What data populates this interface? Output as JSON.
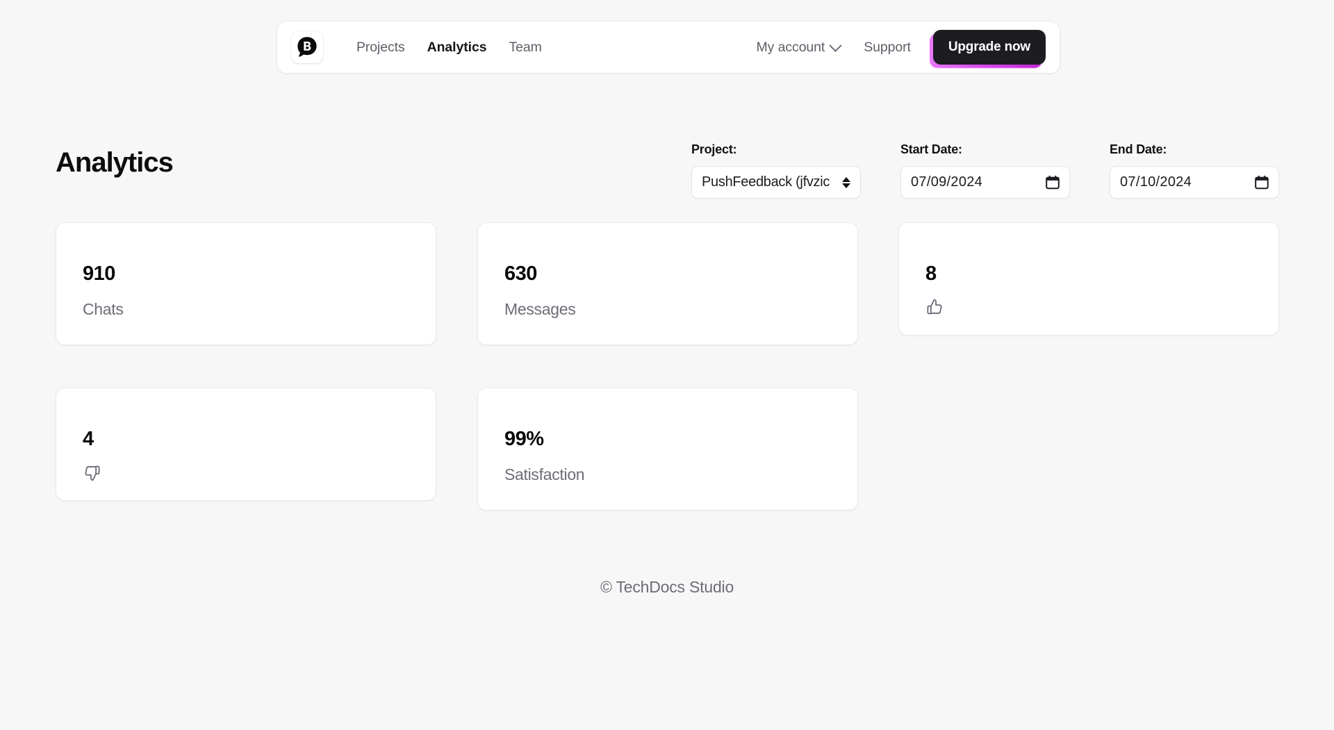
{
  "brand": {
    "logo_icon": "speech-bubble-b-logo",
    "logo_letter": "B"
  },
  "nav": {
    "links": [
      {
        "label": "Projects",
        "active": false
      },
      {
        "label": "Analytics",
        "active": true
      },
      {
        "label": "Team",
        "active": false
      }
    ],
    "account": {
      "label": "My account",
      "chevron_icon": "chevron-down-icon"
    },
    "support_label": "Support",
    "upgrade_label": "Upgrade now",
    "upgrade_glow_color": "#d946ef",
    "upgrade_bg_color": "#1c1c21"
  },
  "header": {
    "title": "Analytics"
  },
  "filters": {
    "project": {
      "label": "Project:",
      "value": "PushFeedback (jfvzic",
      "arrow_icon": "select-updown-icon"
    },
    "start_date": {
      "label": "Start Date:",
      "value": "07/09/2024",
      "icon": "calendar-icon"
    },
    "end_date": {
      "label": "End Date:",
      "value": "07/10/2024",
      "icon": "calendar-icon"
    }
  },
  "cards": [
    {
      "id": "chats",
      "value": "910",
      "label": "Chats",
      "icon": null
    },
    {
      "id": "messages",
      "value": "630",
      "label": "Messages",
      "icon": null
    },
    {
      "id": "thumbs_up",
      "value": "8",
      "label": null,
      "icon": "thumbs-up-icon"
    },
    {
      "id": "thumbs_down",
      "value": "4",
      "label": null,
      "icon": "thumbs-down-icon"
    },
    {
      "id": "satisfaction",
      "value": "99%",
      "label": "Satisfaction",
      "icon": null
    }
  ],
  "footer": {
    "copyright": "© TechDocs Studio"
  },
  "colors": {
    "page_bg": "#f7f7f8",
    "card_bg": "#ffffff",
    "text_primary": "#09090b",
    "text_muted": "#6c6c76",
    "accent_magenta": "#d946ef"
  }
}
